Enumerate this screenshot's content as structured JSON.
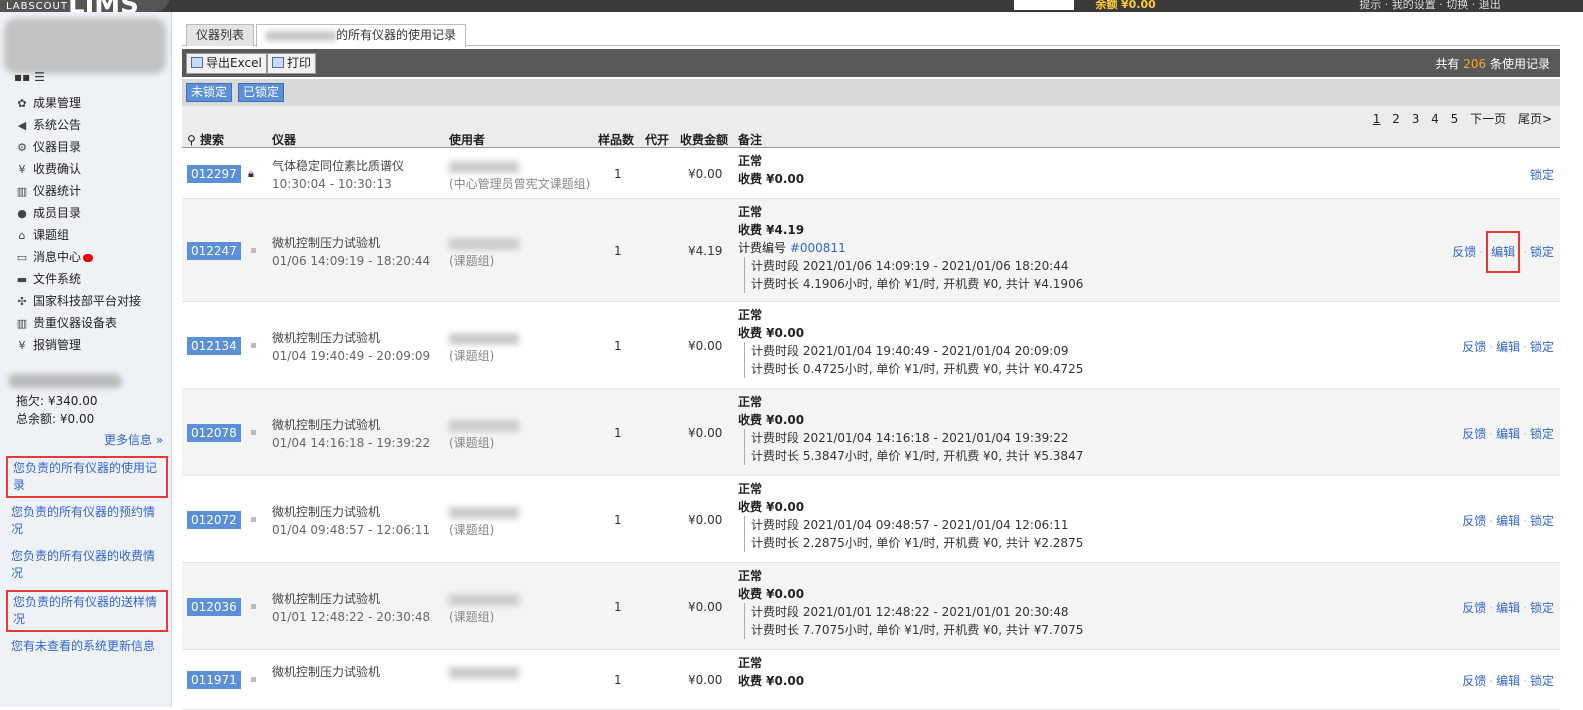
{
  "top": {
    "logo_small": "LABSCOUT",
    "logo_big": "LIMS",
    "balance_label": "余额",
    "balance_value": "¥0.00",
    "right_text": "提示 · 我的设置 · 切换 · 退出"
  },
  "sidebar": {
    "items": [
      {
        "icon": "award-icon",
        "glyph": "✿",
        "label": "成果管理"
      },
      {
        "icon": "megaphone-icon",
        "glyph": "◀",
        "label": "系统公告"
      },
      {
        "icon": "gear-icon",
        "glyph": "⚙",
        "label": "仪器目录"
      },
      {
        "icon": "yen-icon",
        "glyph": "¥",
        "label": "收费确认"
      },
      {
        "icon": "bar-chart-icon",
        "glyph": "▥",
        "label": "仪器统计"
      },
      {
        "icon": "person-icon",
        "glyph": "●",
        "label": "成员目录"
      },
      {
        "icon": "home-icon",
        "glyph": "⌂",
        "label": "课题组"
      },
      {
        "icon": "message-icon",
        "glyph": "▭",
        "label": "消息中心"
      },
      {
        "icon": "folder-icon",
        "glyph": "▬",
        "label": "文件系统"
      },
      {
        "icon": "network-icon",
        "glyph": "✣",
        "label": "国家科技部平台对接"
      },
      {
        "icon": "bar-chart-icon",
        "glyph": "▥",
        "label": "贵重仪器设备表"
      },
      {
        "icon": "yen-icon",
        "glyph": "¥",
        "label": "报销管理"
      }
    ],
    "owe": "拖欠: ¥340.00",
    "total_balance": "总余额: ¥0.00",
    "more": "更多信息 »",
    "links": [
      "您负责的所有仪器的使用记录",
      "您负责的所有仪器的预约情况",
      "您负责的所有仪器的收费情况",
      "您负责的所有仪器的送样情况",
      "您有未查看的系统更新信息"
    ]
  },
  "tabs": {
    "tab1": "仪器列表",
    "tab2": "的所有仪器的使用记录"
  },
  "toolbar": {
    "export": "导出Excel",
    "print": "打印",
    "total_prefix": "共有",
    "total_num": "206",
    "total_suffix": "条使用记录"
  },
  "lockbar": {
    "unlocked": "未锁定",
    "locked": "已锁定"
  },
  "pager": {
    "pages": [
      "1",
      "2",
      "3",
      "4",
      "5"
    ],
    "next": "下一页",
    "last": "尾页>"
  },
  "columns": {
    "search": "搜索",
    "instrument": "仪器",
    "user": "使用者",
    "samples": "样品数",
    "proxy": "代开",
    "amount": "收费金额",
    "note": "备注"
  },
  "rows": [
    {
      "id": "012297",
      "instrument": "气体稳定同位素比质谱仪",
      "time": "10:30:04 - 10:30:13",
      "group": "(中心管理员曾宪文课题组)",
      "samples": "1",
      "amount": "¥0.00",
      "status": "正常",
      "fee": "收费 ¥0.00",
      "bill": "",
      "bill_no": "",
      "period": "",
      "duration": "",
      "feedback": "",
      "edit": "",
      "lock": "锁定"
    },
    {
      "id": "012247",
      "instrument": "微机控制压力试验机",
      "time": "01/06 14:09:19 - 18:20:44",
      "group": "(课题组)",
      "samples": "1",
      "amount": "¥4.19",
      "status": "正常",
      "fee": "收费 ¥4.19",
      "bill": "计费编号",
      "bill_no": "#000811",
      "period": "计费时段 2021/01/06 14:09:19 - 2021/01/06 18:20:44",
      "duration": "计费时长 4.1906小时, 单价 ¥1/时, 开机费 ¥0, 共计 ¥4.1906",
      "feedback": "反馈",
      "edit": "编辑",
      "lock": "锁定"
    },
    {
      "id": "012134",
      "instrument": "微机控制压力试验机",
      "time": "01/04 19:40:49 - 20:09:09",
      "group": "(课题组)",
      "samples": "1",
      "amount": "¥0.00",
      "status": "正常",
      "fee": "收费 ¥0.00",
      "bill": "",
      "bill_no": "",
      "period": "计费时段 2021/01/04 19:40:49 - 2021/01/04 20:09:09",
      "duration": "计费时长 0.4725小时, 单价 ¥1/时, 开机费 ¥0, 共计 ¥0.4725",
      "feedback": "反馈",
      "edit": "编辑",
      "lock": "锁定"
    },
    {
      "id": "012078",
      "instrument": "微机控制压力试验机",
      "time": "01/04 14:16:18 - 19:39:22",
      "group": "(课题组)",
      "samples": "1",
      "amount": "¥0.00",
      "status": "正常",
      "fee": "收费 ¥0.00",
      "bill": "",
      "bill_no": "",
      "period": "计费时段 2021/01/04 14:16:18 - 2021/01/04 19:39:22",
      "duration": "计费时长 5.3847小时, 单价 ¥1/时, 开机费 ¥0, 共计 ¥5.3847",
      "feedback": "反馈",
      "edit": "编辑",
      "lock": "锁定"
    },
    {
      "id": "012072",
      "instrument": "微机控制压力试验机",
      "time": "01/04 09:48:57 - 12:06:11",
      "group": "(课题组)",
      "samples": "1",
      "amount": "¥0.00",
      "status": "正常",
      "fee": "收费 ¥0.00",
      "bill": "",
      "bill_no": "",
      "period": "计费时段 2021/01/04 09:48:57 - 2021/01/04 12:06:11",
      "duration": "计费时长 2.2875小时, 单价 ¥1/时, 开机费 ¥0, 共计 ¥2.2875",
      "feedback": "反馈",
      "edit": "编辑",
      "lock": "锁定"
    },
    {
      "id": "012036",
      "instrument": "微机控制压力试验机",
      "time": "01/01 12:48:22 - 20:30:48",
      "group": "(课题组)",
      "samples": "1",
      "amount": "¥0.00",
      "status": "正常",
      "fee": "收费 ¥0.00",
      "bill": "",
      "bill_no": "",
      "period": "计费时段 2021/01/01 12:48:22 - 2021/01/01 20:30:48",
      "duration": "计费时长 7.7075小时, 单价 ¥1/时, 开机费 ¥0, 共计 ¥7.7075",
      "feedback": "反馈",
      "edit": "编辑",
      "lock": "锁定"
    },
    {
      "id": "011971",
      "instrument": "微机控制压力试验机",
      "time": "",
      "group": "",
      "samples": "1",
      "amount": "¥0.00",
      "status": "正常",
      "fee": "收费 ¥0.00",
      "bill": "",
      "bill_no": "",
      "period": "",
      "duration": "",
      "feedback": "反馈",
      "edit": "编辑",
      "lock": "锁定"
    }
  ]
}
